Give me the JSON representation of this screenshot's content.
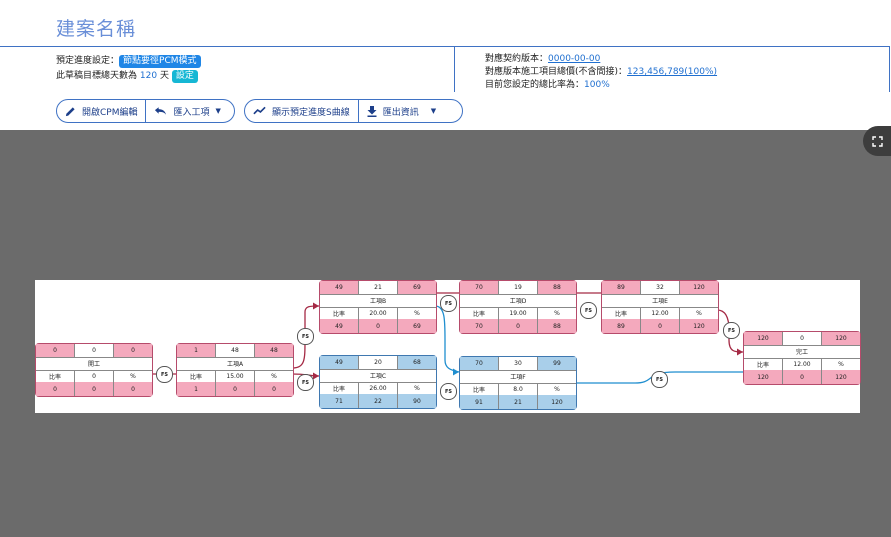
{
  "page": {
    "title": "建案名稱"
  },
  "info": {
    "schedule_label": "預定進度設定：",
    "schedule_mode": "節點要徑PCM模式",
    "days_prefix": "此草稿目標總天數為",
    "days_value": "120",
    "days_unit": "天",
    "set_button": "設定",
    "contract_label": "對應契約版本：",
    "contract_value": "0000-00-00",
    "amount_label": "對應版本施工項目總價(不含間接)：",
    "amount_value": "123,456,789(100%)",
    "ratio_label": "目前您設定的總比率為：",
    "ratio_value": "100%"
  },
  "toolbar": {
    "open_cpm": "開啟CPM編輯",
    "import_item": "匯入工項",
    "show_curve": "顯示預定進度S曲線",
    "export_info": "匯出資訊"
  },
  "colors": {
    "accent": "#3f72c4",
    "pink": "#f4a9bd",
    "light_blue": "#a9cfea",
    "arrow_red": "#a52a45",
    "arrow_blue": "#1f8ecf"
  },
  "nodes": [
    {
      "id": "start",
      "name": "開工",
      "es": "0",
      "dur": "0",
      "ef": "0",
      "ratio_label": "比率",
      "ratio": "0",
      "unit": "%",
      "ls": "0",
      "tf": "0",
      "lf": "0",
      "type": "pink"
    },
    {
      "id": "a",
      "name": "工項A",
      "es": "1",
      "dur": "48",
      "ef": "48",
      "ratio_label": "比率",
      "ratio": "15.00",
      "unit": "%",
      "ls": "1",
      "tf": "0",
      "lf": "0",
      "type": "pink"
    },
    {
      "id": "b",
      "name": "工項B",
      "es": "49",
      "dur": "21",
      "ef": "69",
      "ratio_label": "比率",
      "ratio": "20.00",
      "unit": "%",
      "ls": "49",
      "tf": "0",
      "lf": "69",
      "type": "pink"
    },
    {
      "id": "c",
      "name": "工項C",
      "es": "49",
      "dur": "20",
      "ef": "68",
      "ratio_label": "比率",
      "ratio": "26.00",
      "unit": "%",
      "ls": "71",
      "tf": "22",
      "lf": "90",
      "type": "blue"
    },
    {
      "id": "d",
      "name": "工項D",
      "es": "70",
      "dur": "19",
      "ef": "88",
      "ratio_label": "比率",
      "ratio": "19.00",
      "unit": "%",
      "ls": "70",
      "tf": "0",
      "lf": "88",
      "type": "pink"
    },
    {
      "id": "f",
      "name": "工項F",
      "es": "70",
      "dur": "30",
      "ef": "99",
      "ratio_label": "比率",
      "ratio": "8.0",
      "unit": "%",
      "ls": "91",
      "tf": "21",
      "lf": "120",
      "type": "blue"
    },
    {
      "id": "e",
      "name": "工項E",
      "es": "89",
      "dur": "32",
      "ef": "120",
      "ratio_label": "比率",
      "ratio": "12.00",
      "unit": "%",
      "ls": "89",
      "tf": "0",
      "lf": "120",
      "type": "pink"
    },
    {
      "id": "end",
      "name": "完工",
      "es": "120",
      "dur": "0",
      "ef": "120",
      "ratio_label": "比率",
      "ratio": "12.00",
      "unit": "%",
      "ls": "120",
      "tf": "0",
      "lf": "120",
      "type": "pink"
    }
  ],
  "link_label": "FS"
}
